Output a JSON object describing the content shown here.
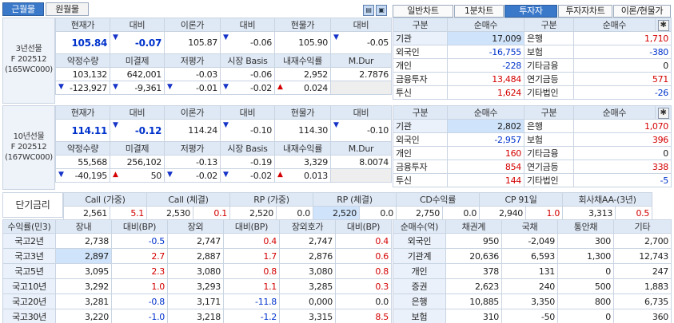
{
  "tabs": {
    "monthly_recent": "근월물",
    "monthly_far": "원월물"
  },
  "right_tabs": [
    "일반차트",
    "1분차트",
    "투자자",
    "투자자차트",
    "이론/현물가"
  ],
  "futures_3y": {
    "side_label": "3년선물\nF 202512\n(165WC000)",
    "h1": [
      "현재가",
      "대비",
      "이론가",
      "대비",
      "현물가",
      "대비"
    ],
    "v1": [
      "105.84",
      "-0.07",
      "105.87",
      "-0.06",
      "105.90",
      "-0.05"
    ],
    "h2": [
      "약정수량",
      "미결제",
      "저평가",
      "시장 Basis",
      "내재수익률",
      "M.Dur"
    ],
    "v2": [
      "103,132",
      "642,001",
      "-0.03",
      "-0.06",
      "2,952",
      "2.7876"
    ],
    "v3": [
      "-123,927",
      "-9,361",
      "-0.01",
      "-0.02",
      "0.024",
      ""
    ]
  },
  "futures_10y": {
    "side_label": "10년선물\nF 202512\n(167WC000)",
    "h1": [
      "현재가",
      "대비",
      "이론가",
      "대비",
      "현물가",
      "대비"
    ],
    "v1": [
      "114.11",
      "-0.12",
      "114.24",
      "-0.10",
      "114.30",
      "-0.10"
    ],
    "h2": [
      "약정수량",
      "미결제",
      "저평가",
      "시장 Basis",
      "내재수익률",
      "M.Dur"
    ],
    "v2": [
      "55,568",
      "256,102",
      "-0.13",
      "-0.19",
      "3,329",
      "8.0074"
    ],
    "v3": [
      "-40,195",
      "50",
      "-0.02",
      "-0.02",
      "0.013",
      ""
    ]
  },
  "investors_3y": {
    "headers": [
      "구분",
      "순매수",
      "구분",
      "순매수"
    ],
    "rows": [
      [
        "기관",
        "17,009",
        "은행",
        "1,710"
      ],
      [
        "외국인",
        "-16,755",
        "보험",
        "-380"
      ],
      [
        "개인",
        "-228",
        "기타금융",
        "0"
      ],
      [
        "금융투자",
        "13,484",
        "연기금등",
        "571"
      ],
      [
        "투신",
        "1,624",
        "기타법인",
        "-26"
      ]
    ]
  },
  "investors_10y": {
    "headers": [
      "구분",
      "순매수",
      "구분",
      "순매수"
    ],
    "rows": [
      [
        "기관",
        "2,802",
        "은행",
        "1,070"
      ],
      [
        "외국인",
        "-2,957",
        "보험",
        "396"
      ],
      [
        "개인",
        "160",
        "기타금융",
        "0"
      ],
      [
        "금융투자",
        "854",
        "연기금등",
        "338"
      ],
      [
        "투신",
        "144",
        "기타법인",
        "-5"
      ]
    ]
  },
  "short_rate": {
    "label": "단기금리",
    "headers": [
      "Call (가중)",
      "Call (체결)",
      "RP (가중)",
      "RP (체결)",
      "CD수익률",
      "CP 91일",
      "회사채AA-(3년)"
    ],
    "values": [
      [
        "2,561",
        "5.1"
      ],
      [
        "2,530",
        "0.1"
      ],
      [
        "2,520",
        "0.0"
      ],
      [
        "2,520",
        "0.0"
      ],
      [
        "2,750",
        "0.0"
      ],
      [
        "2,940",
        "1.0"
      ],
      [
        "3,313",
        "0.5"
      ]
    ]
  },
  "yields": {
    "headers": [
      "수익률(민3)",
      "장내",
      "대비(BP)",
      "장외",
      "대비(BP)",
      "장외호가",
      "대비(BP)"
    ],
    "rows": [
      [
        "국고2년",
        "2,738",
        "-0.5",
        "2,747",
        "0.4",
        "2,747",
        "0.4"
      ],
      [
        "국고3년",
        "2,897",
        "2.7",
        "2,887",
        "1.7",
        "2,876",
        "0.6"
      ],
      [
        "국고5년",
        "3,095",
        "2.3",
        "3,080",
        "0.8",
        "3,080",
        "0.8"
      ],
      [
        "국고10년",
        "3,292",
        "1.0",
        "3,293",
        "1.1",
        "3,285",
        "0.3"
      ],
      [
        "국고20년",
        "3,281",
        "-0.8",
        "3,171",
        "-11.8",
        "0,000",
        "0.0"
      ],
      [
        "국고30년",
        "3,220",
        "-1.0",
        "3,218",
        "-1.2",
        "3,315",
        "8.5"
      ]
    ]
  },
  "bond_net": {
    "headers": [
      "순매수(억)",
      "채권계",
      "국채",
      "통안채",
      "기타"
    ],
    "rows": [
      [
        "외국인",
        "950",
        "-2,049",
        "300",
        "2,700"
      ],
      [
        "기관계",
        "20,636",
        "6,593",
        "1,300",
        "12,743"
      ],
      [
        "개인",
        "378",
        "131",
        "0",
        "247"
      ],
      [
        "증권",
        "2,623",
        "240",
        "500",
        "1,883"
      ],
      [
        "은행",
        "10,885",
        "3,350",
        "800",
        "6,735"
      ],
      [
        "보험",
        "310",
        "-50",
        "0",
        "360"
      ]
    ]
  },
  "colors": {
    "header_bg": "#dfe9f6",
    "up": "#d40000",
    "down": "#0033cc",
    "active_tab": "#3a78c9"
  }
}
